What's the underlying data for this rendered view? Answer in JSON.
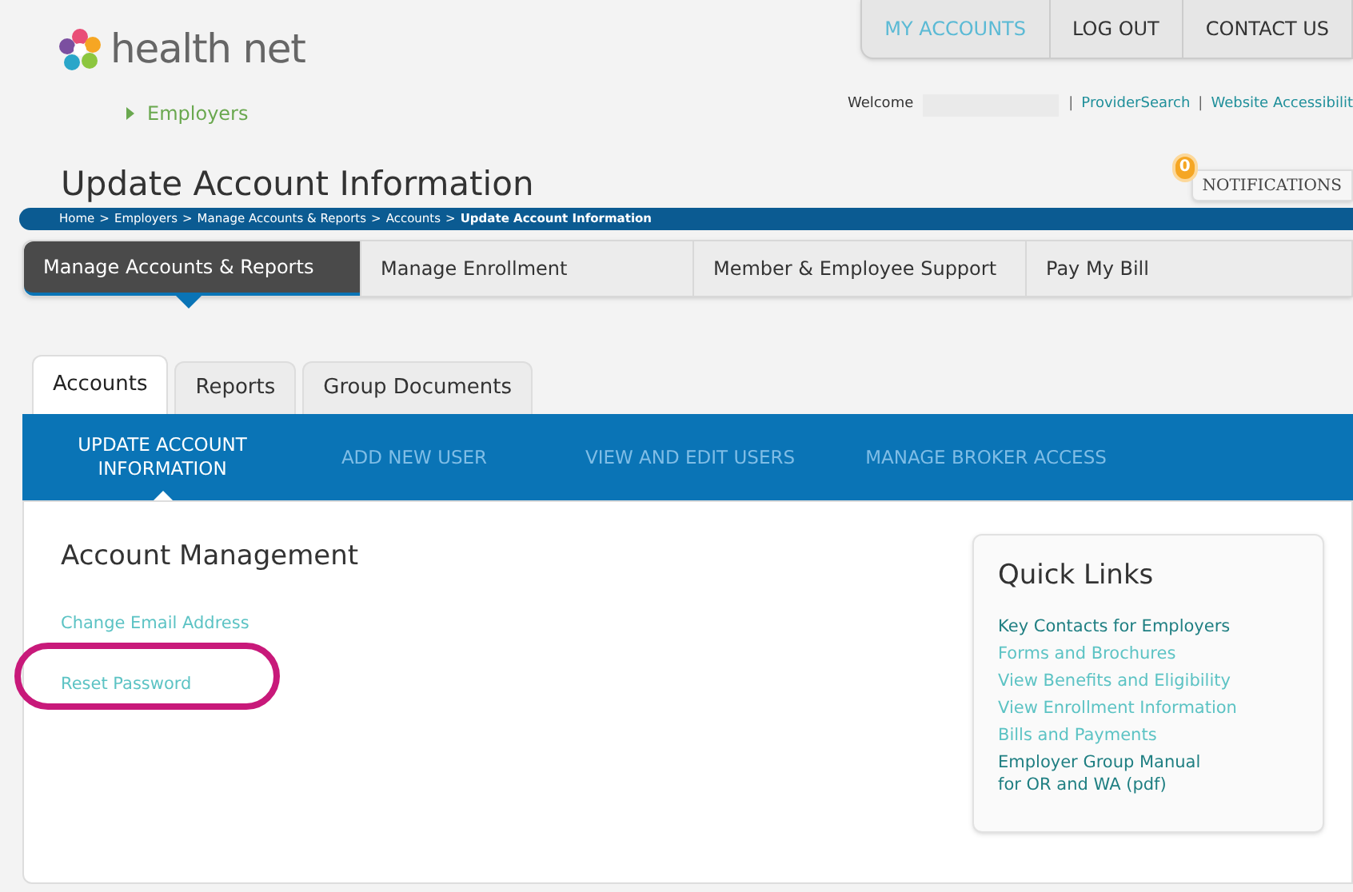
{
  "header": {
    "logo_text": "health net",
    "top_nav": [
      {
        "label": "MY ACCOUNTS",
        "selected": true
      },
      {
        "label": "LOG OUT",
        "selected": false
      },
      {
        "label": "CONTACT US",
        "selected": false
      }
    ],
    "section_link": "Employers",
    "welcome": "Welcome",
    "utility_items": [
      {
        "kind": "separator",
        "text": "|"
      },
      {
        "kind": "link",
        "text": "ProviderSearch"
      },
      {
        "kind": "separator",
        "text": "|"
      },
      {
        "kind": "link",
        "text": "Website Accessibilit"
      }
    ],
    "notifications": {
      "count": "0",
      "label": "NOTIFICATIONS"
    }
  },
  "page_title": "Update Account Information",
  "breadcrumb": [
    {
      "kind": "link",
      "text": "Home"
    },
    {
      "kind": "separator",
      "text": ">"
    },
    {
      "kind": "link",
      "text": "Employers"
    },
    {
      "kind": "separator",
      "text": ">"
    },
    {
      "kind": "link",
      "text": "Manage Accounts & Reports"
    },
    {
      "kind": "separator",
      "text": ">"
    },
    {
      "kind": "link",
      "text": "Accounts"
    },
    {
      "kind": "separator",
      "text": ">"
    },
    {
      "kind": "current",
      "text": "Update Account Information"
    }
  ],
  "main_nav": [
    {
      "label": "Manage Accounts & Reports",
      "selected": true
    },
    {
      "label": "Manage Enrollment",
      "selected": false
    },
    {
      "label": "Member & Employee Support",
      "selected": false
    },
    {
      "label": "Pay My Bill",
      "selected": false
    }
  ],
  "tabs": [
    {
      "label": "Accounts",
      "selected": true
    },
    {
      "label": "Reports",
      "selected": false
    },
    {
      "label": "Group Documents",
      "selected": false
    }
  ],
  "sub_nav": [
    {
      "label": "UPDATE ACCOUNT INFORMATION",
      "selected": true
    },
    {
      "label": "ADD NEW USER",
      "selected": false
    },
    {
      "label": "VIEW AND EDIT USERS",
      "selected": false
    },
    {
      "label": "MANAGE BROKER ACCESS",
      "selected": false
    }
  ],
  "account_management": {
    "heading": "Account Management",
    "links": [
      {
        "label": "Change Email Address",
        "highlighted": false
      },
      {
        "label": "Reset Password",
        "highlighted": true
      }
    ]
  },
  "quick_links": {
    "heading": "Quick Links",
    "links": [
      {
        "label": "Key Contacts for Employers",
        "color": "#1f7f82"
      },
      {
        "label": "Forms and Brochures",
        "color": "#5cc3c4"
      },
      {
        "label": "View Benefits and Eligibility",
        "color": "#5cc3c4"
      },
      {
        "label": "View Enrollment Information",
        "color": "#5cc3c4"
      },
      {
        "label": "Bills and Payments",
        "color": "#5cc3c4"
      },
      {
        "label": "Employer Group Manual\nfor OR and WA (pdf)",
        "color": "#1f7f82"
      }
    ]
  }
}
